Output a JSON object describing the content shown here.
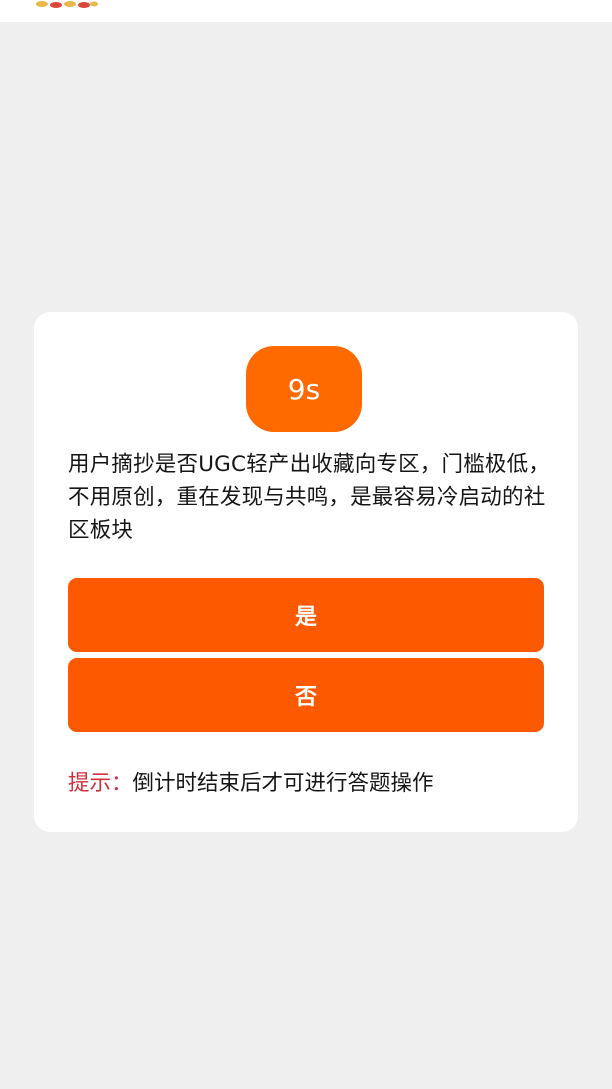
{
  "colors": {
    "accent": "#fd5900",
    "timer_bg": "#ff6a00",
    "hint_label": "#d0303a",
    "page_bg": "#efefef"
  },
  "timer": {
    "label": "9s"
  },
  "question": {
    "text": "用户摘抄是否UGC轻产出收藏向专区，门槛极低，不用原创，重在发现与共鸣，是最容易冷启动的社区板块"
  },
  "answers": {
    "yes_label": "是",
    "no_label": "否"
  },
  "hint": {
    "label": "提示：",
    "text": "倒计时结束后才可进行答题操作"
  }
}
